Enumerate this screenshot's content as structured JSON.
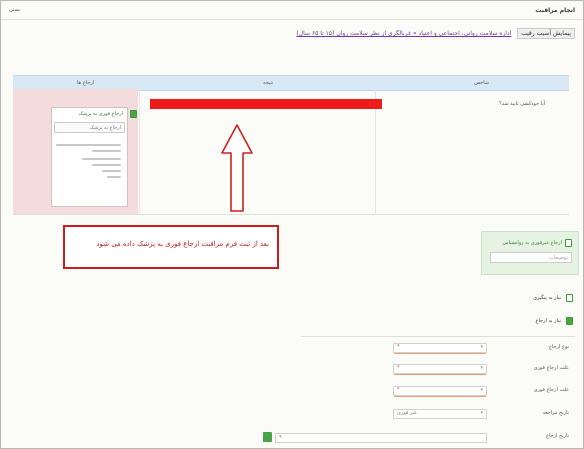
{
  "header": {
    "title": "انجام مراقبت",
    "close": "بستن"
  },
  "breadcrumb": {
    "nav": "پیمایش آسیب رقیب",
    "path": "اداره سلامت روانی، اجتماعی و اعتیاد » غربالگری از نظر سلامت روان (۱۵ تا ۶۵ سال)"
  },
  "table": {
    "headers": [
      "شاخص",
      "نتیجه",
      "ارجاع ها"
    ],
    "left_panel": {
      "header": "ارجاع فوری به پزشک",
      "field_label": "ارجاع به پزشک"
    }
  },
  "result_question": "آیا خودکشی تایید شد؟",
  "callout": {
    "text": "بعد از ثبت فرم مراقبت ارجاع فوری به پزشک داده می شود"
  },
  "green_box": {
    "label": "ارجاع غیرفوری به روانشناس",
    "placeholder": "توضیحات"
  },
  "checks": [
    {
      "label": "نیاز به پیگیری",
      "checked": false
    },
    {
      "label": "نیاز به ارجاع",
      "checked": true
    }
  ],
  "form": [
    {
      "label": "نوع ارجاع",
      "value": "*"
    },
    {
      "label": "علت ارجاع فوری",
      "value": "*"
    },
    {
      "label": "علت ارجاع فوری",
      "value": "*"
    },
    {
      "label": "تاریخ مراجعه",
      "value": "غیر فوری"
    },
    {
      "label": "تاریخ ارجاع",
      "value": "۹"
    }
  ],
  "colors": {
    "accent_red": "#ee1b1b",
    "callout_border": "#c81e1e",
    "arrow": "#d21f1f",
    "table_header": "#d8e8f4",
    "left_panel_bg": "#f4dcdc",
    "green_box_bg": "#e6f3e2",
    "field_underline": "#e8a07a"
  }
}
